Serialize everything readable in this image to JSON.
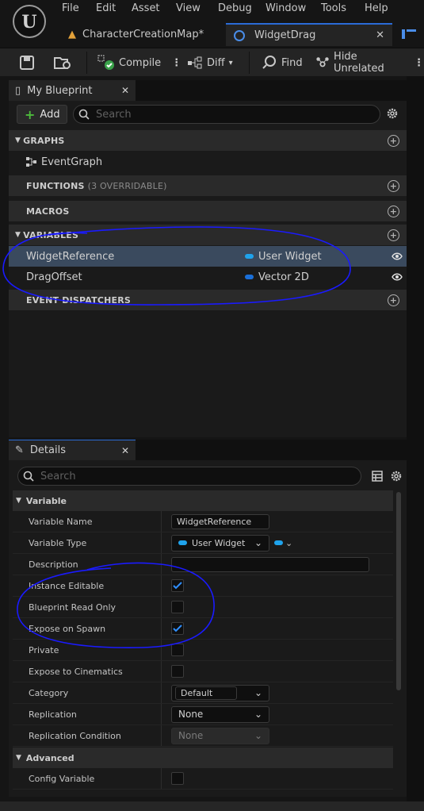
{
  "menu": [
    "File",
    "Edit",
    "Asset",
    "View",
    "Debug",
    "Window",
    "Tools",
    "Help"
  ],
  "tabs": [
    {
      "label": "CharacterCreationMap*"
    },
    {
      "label": "WidgetDrag"
    }
  ],
  "toolbar": {
    "compile": "Compile",
    "diff": "Diff",
    "find": "Find",
    "hide_unrelated": "Hide Unrelated"
  },
  "my_blueprint": {
    "tab": "My Blueprint",
    "add": "Add",
    "search_placeholder": "Search",
    "graphs": "GRAPHS",
    "event_graph": "EventGraph",
    "functions": "FUNCTIONS",
    "functions_note": "(3 OVERRIDABLE)",
    "macros": "MACROS",
    "variables": "VARIABLES",
    "vars": [
      {
        "name": "WidgetReference",
        "type": "User Widget",
        "type_color": "#1fa3ec"
      },
      {
        "name": "DragOffset",
        "type": "Vector 2D",
        "type_color": "#1a6fd8"
      }
    ],
    "event_dispatchers": "EVENT DISPATCHERS"
  },
  "details": {
    "tab": "Details",
    "search_placeholder": "Search",
    "section_variable": "Variable",
    "variable_name_label": "Variable Name",
    "variable_name_value": "WidgetReference",
    "variable_type_label": "Variable Type",
    "variable_type_value": "User Widget",
    "description_label": "Description",
    "instance_editable_label": "Instance Editable",
    "instance_editable": true,
    "blueprint_read_only_label": "Blueprint Read Only",
    "blueprint_read_only": false,
    "expose_on_spawn_label": "Expose on Spawn",
    "expose_on_spawn": true,
    "private_label": "Private",
    "private": false,
    "expose_cinematics_label": "Expose to Cinematics",
    "expose_cinematics": false,
    "category_label": "Category",
    "category_value": "Default",
    "replication_label": "Replication",
    "replication_value": "None",
    "replication_condition_label": "Replication Condition",
    "replication_condition_value": "None",
    "section_advanced": "Advanced",
    "config_variable_label": "Config Variable",
    "config_variable": false
  },
  "colors": {
    "accent": "#2a6bd6",
    "annotation": "#1a1aff",
    "selected_row": "#3a4a5e"
  }
}
